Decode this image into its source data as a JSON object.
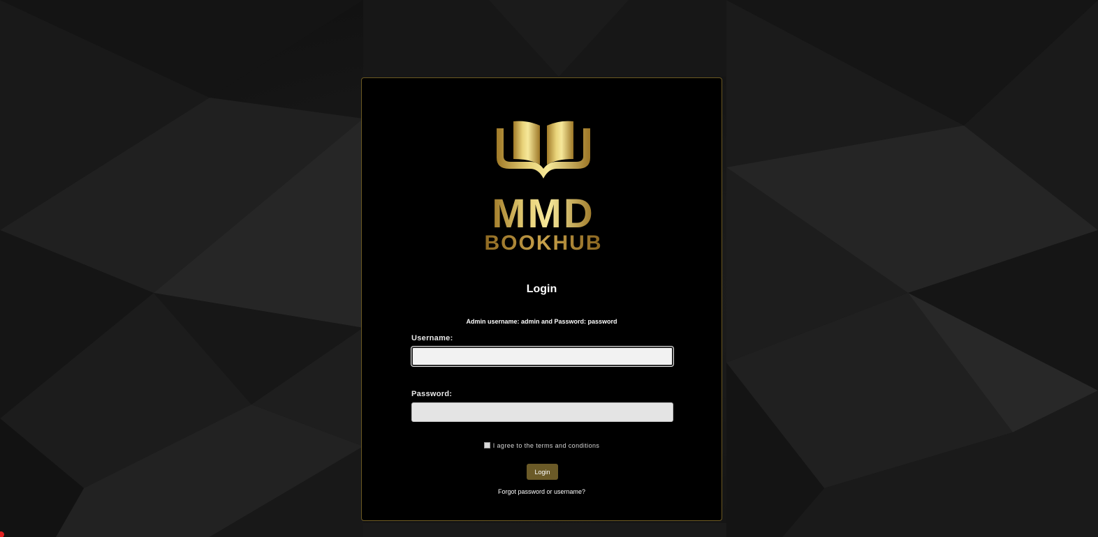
{
  "colors": {
    "card_background": "#000000",
    "card_border": "#6d5a22",
    "gold_light": "#f3e48a",
    "gold_dark": "#9a7424",
    "button_background": "#6b5a27",
    "page_background": "#161616"
  },
  "logo": {
    "icon": "open-book-icon",
    "line1": "MMD",
    "line2": "BOOKHUB"
  },
  "login": {
    "title": "Login",
    "admin_hint": "Admin username: admin and Password: password",
    "username_label": "Username:",
    "username_value": "",
    "password_label": "Password:",
    "password_value": "",
    "terms_label": "I agree to the terms and conditions",
    "terms_checked": false,
    "button_label": "Login",
    "forgot_link": "Forgot password or username?"
  }
}
